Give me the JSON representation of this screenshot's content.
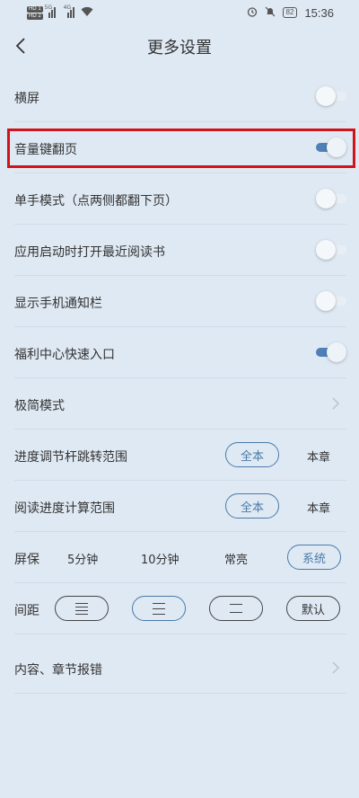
{
  "status_bar": {
    "hd1": "HD 1",
    "hd2": "HD 2",
    "sig1_tag": "5G",
    "sig2_tag": "4G",
    "battery": "82",
    "time": "15:36"
  },
  "header": {
    "title": "更多设置"
  },
  "settings": {
    "landscape": {
      "label": "横屏",
      "on": false
    },
    "volume_page": {
      "label": "音量键翻页",
      "on": true
    },
    "one_hand": {
      "label": "单手模式（点两侧都翻下页）",
      "on": false
    },
    "open_recent": {
      "label": "应用启动时打开最近阅读书",
      "on": false
    },
    "show_notification": {
      "label": "显示手机通知栏",
      "on": false
    },
    "welfare_entry": {
      "label": "福利中心快速入口",
      "on": true
    },
    "minimal_mode": {
      "label": "极简模式"
    },
    "progress_jump": {
      "label": "进度调节杆跳转范围",
      "option_all": "全本",
      "option_chapter": "本章",
      "selected": "全本"
    },
    "progress_calc": {
      "label": "阅读进度计算范围",
      "option_all": "全本",
      "option_chapter": "本章",
      "selected": "全本"
    },
    "screensaver": {
      "label": "屏保",
      "opt1": "5分钟",
      "opt2": "10分钟",
      "opt3": "常亮",
      "opt4": "系统",
      "selected": "系统"
    },
    "spacing": {
      "label": "间距",
      "opt_default": "默认",
      "selected": "second"
    },
    "report_error": {
      "label": "内容、章节报错"
    }
  },
  "colors": {
    "background": "#dfe9f3",
    "accent": "#4a7aaa",
    "toggle_on": "#4f7fb7",
    "highlight_box": "#d0141c"
  }
}
